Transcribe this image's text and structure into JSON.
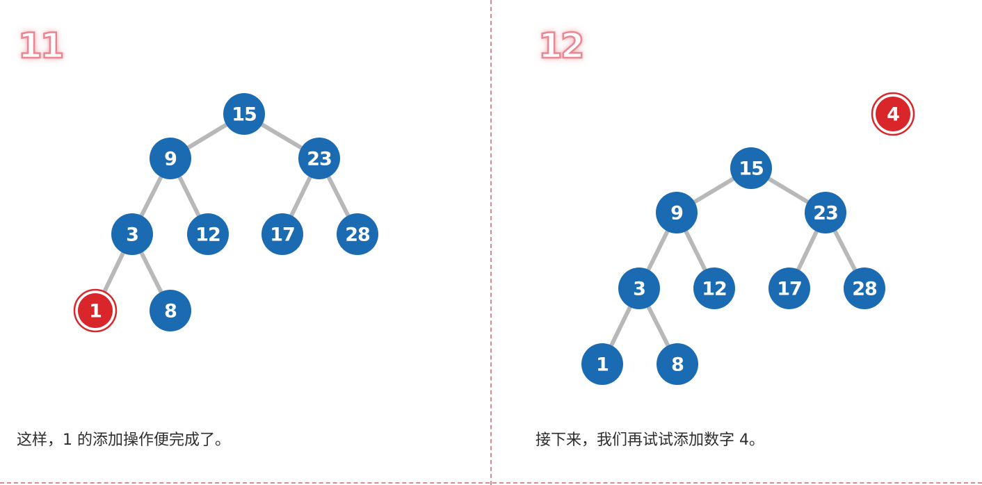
{
  "colors": {
    "node_fill": "#1b6bb3",
    "highlight_fill": "#d9262b",
    "highlight_ring": "#d9262b",
    "edge": "#b8b8b8",
    "accent_pink": "#e98690",
    "text": "#2d2d2d"
  },
  "panels": [
    {
      "step": "11",
      "caption": "这样，1 的添加操作便完成了。",
      "tree": {
        "nodes": [
          {
            "id": "n15",
            "label": "15"
          },
          {
            "id": "n9",
            "label": "9"
          },
          {
            "id": "n23",
            "label": "23"
          },
          {
            "id": "n3",
            "label": "3"
          },
          {
            "id": "n12",
            "label": "12"
          },
          {
            "id": "n17",
            "label": "17"
          },
          {
            "id": "n28",
            "label": "28"
          },
          {
            "id": "n1",
            "label": "1",
            "highlight": true
          },
          {
            "id": "n8",
            "label": "8"
          }
        ],
        "edges": [
          [
            "n15",
            "n9"
          ],
          [
            "n15",
            "n23"
          ],
          [
            "n9",
            "n3"
          ],
          [
            "n9",
            "n12"
          ],
          [
            "n23",
            "n17"
          ],
          [
            "n23",
            "n28"
          ],
          [
            "n3",
            "n1"
          ],
          [
            "n3",
            "n8"
          ]
        ]
      }
    },
    {
      "step": "12",
      "caption": "接下来，我们再试试添加数字 4。",
      "tree": {
        "nodes": [
          {
            "id": "n15",
            "label": "15"
          },
          {
            "id": "n9",
            "label": "9"
          },
          {
            "id": "n23",
            "label": "23"
          },
          {
            "id": "n3",
            "label": "3"
          },
          {
            "id": "n12",
            "label": "12"
          },
          {
            "id": "n17",
            "label": "17"
          },
          {
            "id": "n28",
            "label": "28"
          },
          {
            "id": "n1",
            "label": "1"
          },
          {
            "id": "n8",
            "label": "8"
          }
        ],
        "edges": [
          [
            "n15",
            "n9"
          ],
          [
            "n15",
            "n23"
          ],
          [
            "n9",
            "n3"
          ],
          [
            "n9",
            "n12"
          ],
          [
            "n23",
            "n17"
          ],
          [
            "n23",
            "n28"
          ],
          [
            "n3",
            "n1"
          ],
          [
            "n3",
            "n8"
          ]
        ],
        "pending": {
          "id": "n4",
          "label": "4",
          "highlight": true
        }
      }
    }
  ]
}
